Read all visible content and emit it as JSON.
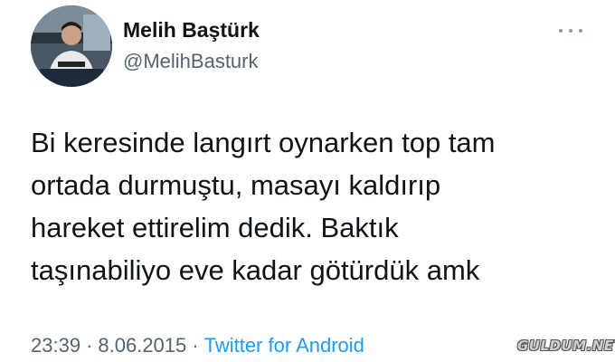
{
  "author": {
    "display_name": "Melih Baştürk",
    "handle": "@MelihBasturk"
  },
  "tweet": {
    "lines": [
      "Bi keresinde langırt oynarken top tam",
      "ortada durmuştu, masayı kaldırıp",
      "hareket ettirelim dedik. Baktık",
      "taşınabiliyo eve kadar götürdük amk"
    ],
    "time": "23:39",
    "date": "8.06.2015",
    "separator": "·",
    "source": "Twitter for Android"
  },
  "icons": {
    "more": "more-options-icon"
  },
  "watermark": "GULDUM.NET",
  "colors": {
    "text": "#0f1419",
    "secondary": "#536471",
    "link": "#1d9bf0"
  }
}
